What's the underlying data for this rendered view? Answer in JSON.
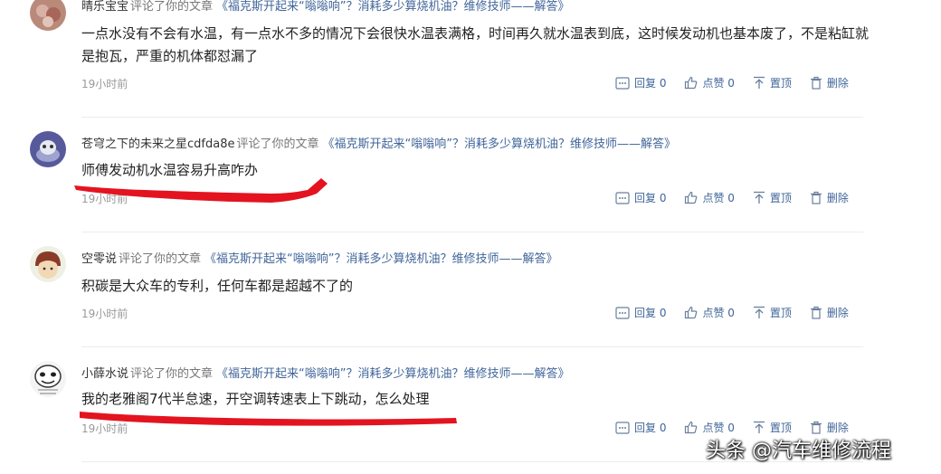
{
  "comments": [
    {
      "user": "晴乐宝宝",
      "verb": "评论了你的文章",
      "article": "《福克斯开起来“嗡嗡响”？消耗多少算烧机油？维修技师——解答》",
      "text": "一点水没有不会有水温，有一点水不多的情况下会很快水温表满格，时间再久就水温表到底，这时候发动机也基本废了，不是粘缸就是抱瓦，严重的机体都怼漏了",
      "time": "19小时前",
      "reply": "回复 0",
      "like": "点赞 0",
      "pin": "置顶",
      "delete": "删除"
    },
    {
      "user": "苍穹之下的未来之星cdfda8e",
      "verb": "评论了你的文章",
      "article": "《福克斯开起来“嗡嗡响”？消耗多少算烧机油？维修技师——解答》",
      "text": "师傅发动机水温容易升高咋办",
      "time": "19小时前",
      "reply": "回复 0",
      "like": "点赞 0",
      "pin": "置顶",
      "delete": "删除"
    },
    {
      "user": "空零说",
      "verb": "评论了你的文章",
      "article": "《福克斯开起来“嗡嗡响”？消耗多少算烧机油？维修技师——解答》",
      "text": "积碳是大众车的专利，任何车都是超越不了的",
      "time": "19小时前",
      "reply": "回复 0",
      "like": "点赞 0",
      "pin": "置顶",
      "delete": "删除"
    },
    {
      "user": "小薛水说",
      "verb": "评论了你的文章",
      "article": "《福克斯开起来“嗡嗡响”？消耗多少算烧机油？维修技师——解答》",
      "text": "我的老雅阁7代半怠速，开空调转速表上下跳动，怎么处理",
      "time": "19小时前",
      "reply": "回复 0",
      "like": "点赞 0",
      "pin": "置顶",
      "delete": "删除"
    }
  ],
  "watermark": "头条 @汽车维修流程",
  "colors": {
    "link": "#406599",
    "annotation": "#e3141f",
    "time": "#999999",
    "divider": "#ececec"
  },
  "icons": {
    "reply": "comment-box-icon",
    "like": "thumbs-up-icon",
    "pin": "pin-top-icon",
    "delete": "trash-icon"
  }
}
